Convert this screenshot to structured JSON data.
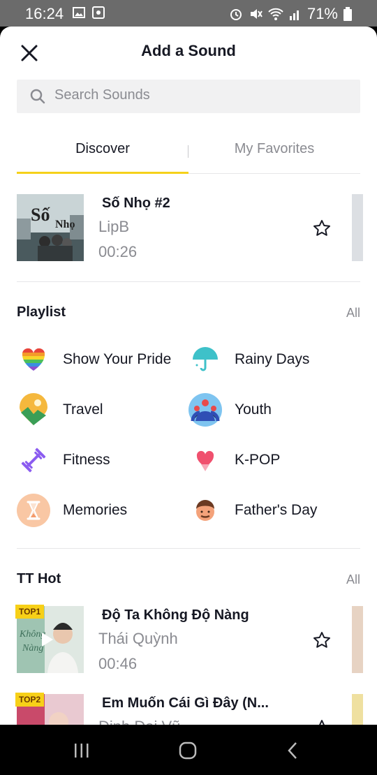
{
  "status": {
    "time": "16:24",
    "battery": "71%"
  },
  "header": {
    "title": "Add a Sound"
  },
  "search": {
    "placeholder": "Search Sounds"
  },
  "tabs": [
    {
      "label": "Discover"
    },
    {
      "label": "My Favorites"
    }
  ],
  "featured": {
    "title": "Số Nhọ #2",
    "artist": "LipB",
    "duration": "00:26"
  },
  "playlist": {
    "title": "Playlist",
    "all_label": "All",
    "items": [
      {
        "label": "Show Your Pride",
        "icon": "rainbow-heart-icon"
      },
      {
        "label": "Rainy Days",
        "icon": "umbrella-icon"
      },
      {
        "label": "Travel",
        "icon": "map-pin-icon"
      },
      {
        "label": "Youth",
        "icon": "people-icon"
      },
      {
        "label": "Fitness",
        "icon": "dumbbell-icon"
      },
      {
        "label": "K-POP",
        "icon": "heart-hand-icon"
      },
      {
        "label": "Memories",
        "icon": "hourglass-icon"
      },
      {
        "label": "Father's Day",
        "icon": "father-face-icon"
      }
    ]
  },
  "tthot": {
    "title": "TT Hot",
    "all_label": "All",
    "songs": [
      {
        "badge": "TOP1",
        "title": "Độ Ta Không Độ Nàng",
        "artist": "Thái Quỳnh",
        "duration": "00:46"
      },
      {
        "badge": "TOP2",
        "title": "Em Muốn Cái Gì Đây (N...",
        "artist": "Đinh Đại Vũ",
        "duration": ""
      }
    ]
  },
  "colors": {
    "accent": "#f5d11a",
    "text": "#161823",
    "muted": "#8a8b91"
  }
}
